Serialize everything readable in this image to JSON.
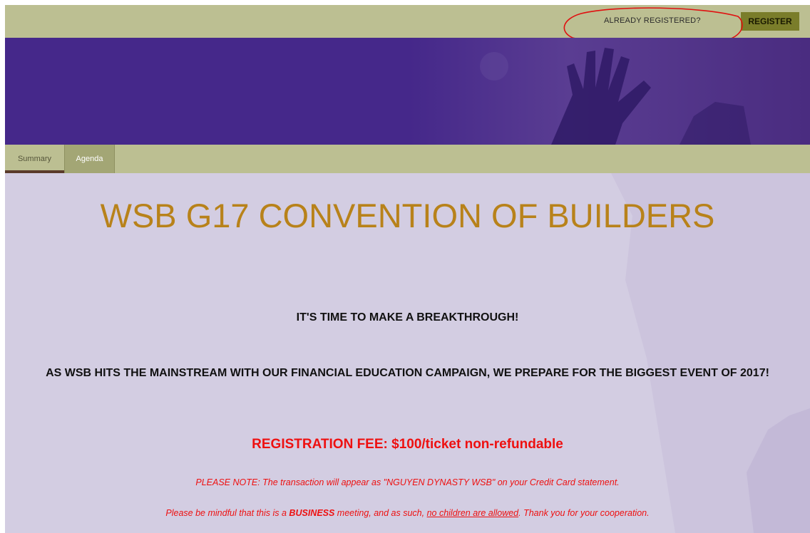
{
  "header": {
    "already_registered": "ALREADY REGISTERED?",
    "register_label": "REGISTER"
  },
  "tabs": [
    {
      "label": "Summary",
      "active": true
    },
    {
      "label": "Agenda",
      "active": false
    }
  ],
  "event": {
    "title": "WSB G17 CONVENTION OF BUILDERS",
    "headline": "IT'S TIME TO MAKE A BREAKTHROUGH!",
    "subheadline": "AS WSB HITS THE MAINSTREAM WITH OUR FINANCIAL EDUCATION CAMPAIGN, WE PREPARE FOR THE BIGGEST EVENT OF 2017!",
    "fee": "REGISTRATION FEE: $100/ticket non-refundable",
    "note": "PLEASE NOTE: The transaction will appear as \"NGUYEN DYNASTY WSB\" on your Credit Card statement.",
    "mindful": {
      "part1": "Please be mindful that this is a ",
      "emphasis": "BUSINESS",
      "part2": " meeting, and as such, ",
      "underlined": "no children are allowed",
      "part3": ". Thank you for your cooperation."
    }
  },
  "colors": {
    "header_bg": "#bcbf92",
    "register_bg": "#7a7d2a",
    "banner_bg": "#45288a",
    "content_bg": "#d3cde2",
    "title": "#b8821a",
    "alert": "#ee1010",
    "annotation": "#e01010"
  },
  "icons": [
    "hand-photo-graphic",
    "annotation-circle"
  ]
}
